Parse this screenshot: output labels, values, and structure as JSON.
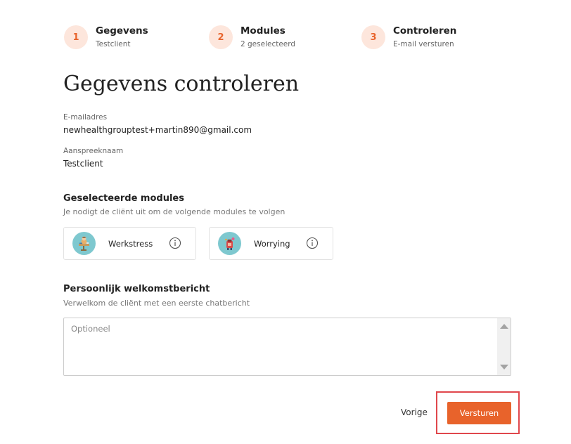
{
  "stepper": {
    "steps": [
      {
        "number": "1",
        "title": "Gegevens",
        "subtitle": "Testclient"
      },
      {
        "number": "2",
        "title": "Modules",
        "subtitle": "2 geselecteerd"
      },
      {
        "number": "3",
        "title": "Controleren",
        "subtitle": "E-mail versturen"
      }
    ]
  },
  "page": {
    "title": "Gegevens controleren"
  },
  "fields": {
    "email": {
      "label": "E-mailadres",
      "value": "newhealthgrouptest+martin890@gmail.com"
    },
    "name": {
      "label": "Aanspreeknaam",
      "value": "Testclient"
    }
  },
  "modules": {
    "title": "Geselecteerde modules",
    "subtitle": "Je nodigt de cliënt uit om de volgende modules te volgen",
    "items": [
      {
        "name": "Werkstress",
        "icon": "werkstress-illustration-icon"
      },
      {
        "name": "Worrying",
        "icon": "worrying-illustration-icon"
      }
    ]
  },
  "welcome": {
    "title": "Persoonlijk welkomstbericht",
    "subtitle": "Verwelkom de cliënt met een eerste chatbericht",
    "placeholder": "Optioneel",
    "value": ""
  },
  "actions": {
    "prev_label": "Vorige",
    "send_label": "Versturen"
  },
  "colors": {
    "accent": "#e8632b",
    "step_circle_bg": "#fde6dc",
    "avatar_bg": "#7ec8cf",
    "highlight_border": "#e0474c"
  }
}
